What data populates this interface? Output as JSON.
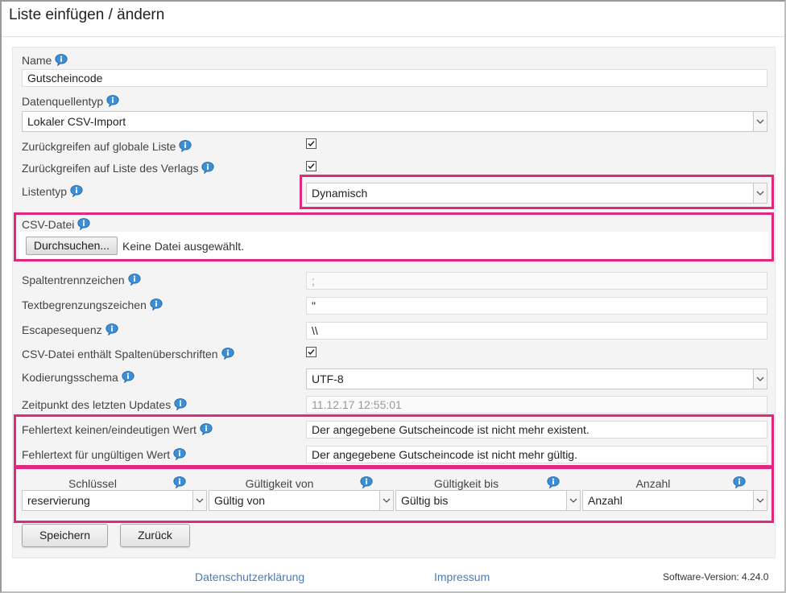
{
  "window": {
    "title": "Liste einfügen / ändern"
  },
  "form": {
    "name": {
      "label": "Name",
      "value": "Gutscheincode"
    },
    "datasource_type": {
      "label": "Datenquellentyp",
      "value": "Lokaler CSV-Import"
    },
    "fallback_global": {
      "label": "Zurückgreifen auf globale Liste",
      "checked": true
    },
    "fallback_publisher": {
      "label": "Zurückgreifen auf Liste des Verlags",
      "checked": true
    },
    "list_type": {
      "label": "Listentyp",
      "value": "Dynamisch"
    },
    "csv_file": {
      "label": "CSV-Datei",
      "button": "Durchsuchen...",
      "status": "Keine Datei ausgewählt."
    },
    "column_separator": {
      "label": "Spaltentrennzeichen",
      "value": ";"
    },
    "text_delimiter": {
      "label": "Textbegrenzungszeichen",
      "value": "\""
    },
    "escape_sequence": {
      "label": "Escapesequenz",
      "value": "\\\\"
    },
    "csv_has_headers": {
      "label": "CSV-Datei enthält Spaltenüberschriften",
      "checked": true
    },
    "encoding": {
      "label": "Kodierungsschema",
      "value": "UTF-8"
    },
    "last_update": {
      "label": "Zeitpunkt des letzten Updates",
      "value": "11.12.17 12:55:01"
    },
    "error_no_unique": {
      "label": "Fehlertext keinen/eindeutigen Wert",
      "value": "Der angegebene Gutscheincode ist nicht mehr existent."
    },
    "error_invalid": {
      "label": "Fehlertext für ungültigen Wert",
      "value": "Der angegebene Gutscheincode ist nicht mehr gültig."
    }
  },
  "mapping": {
    "columns": [
      {
        "header": "Schlüssel",
        "value": "reservierung"
      },
      {
        "header": "Gültigkeit von",
        "value": "Gültig von"
      },
      {
        "header": "Gültigkeit bis",
        "value": "Gültig bis"
      },
      {
        "header": "Anzahl",
        "value": "Anzahl"
      }
    ]
  },
  "buttons": {
    "save": "Speichern",
    "back": "Zurück"
  },
  "footer": {
    "privacy": "Datenschutzerklärung",
    "imprint": "Impressum",
    "version": "Software-Version: 4.24.0"
  },
  "colors": {
    "highlight": "#e0287d",
    "link": "#4a7ab5",
    "info_icon": "#3a8fd6"
  },
  "icons": {
    "info": "info-bubble-icon",
    "dropdown": "chevron-down-icon",
    "checkbox": "checkmark-icon"
  }
}
